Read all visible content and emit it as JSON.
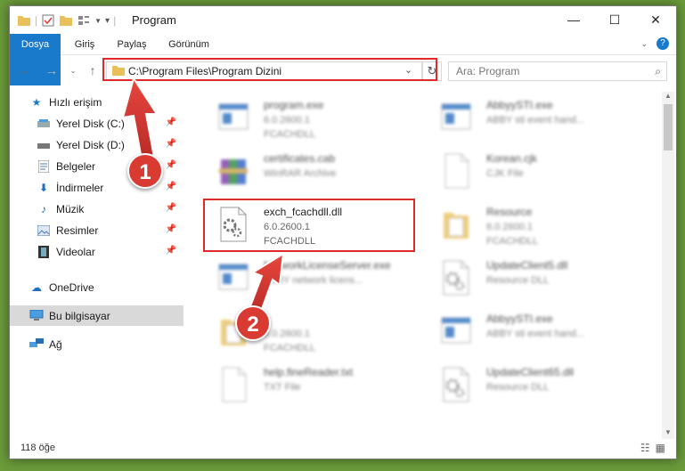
{
  "window": {
    "title": "Program",
    "controls": [
      "—",
      "☐",
      "✕"
    ]
  },
  "ribbon": {
    "tabs": [
      "Dosya",
      "Giriş",
      "Paylaş",
      "Görünüm"
    ],
    "help": "?"
  },
  "address": {
    "path": "C:\\Program Files\\Program Dizini",
    "search_placeholder": "Ara: Program"
  },
  "nav": {
    "quick_access": "Hızlı erişim",
    "items": [
      {
        "label": "Yerel Disk (C:)",
        "icon": "drive-icon",
        "pinned": true
      },
      {
        "label": "Yerel Disk (D:)",
        "icon": "drive-icon",
        "pinned": true
      },
      {
        "label": "Belgeler",
        "icon": "documents-icon",
        "pinned": true
      },
      {
        "label": "İndirmeler",
        "icon": "download-icon",
        "pinned": true
      },
      {
        "label": "Müzik",
        "icon": "music-icon",
        "pinned": true
      },
      {
        "label": "Resimler",
        "icon": "pictures-icon",
        "pinned": true
      },
      {
        "label": "Videolar",
        "icon": "video-icon",
        "pinned": true
      }
    ],
    "onedrive": "OneDrive",
    "this_pc": "Bu bilgisayar",
    "network": "Ağ"
  },
  "files": [
    {
      "name": "program.exe",
      "line2": "6.0.2600.1",
      "line3": "FCACHDLL",
      "icon": "exe-icon",
      "blurred": true
    },
    {
      "name": "AbbyySTI.exe",
      "line2": "ABBY sti event hand...",
      "line3": "",
      "icon": "exe-icon",
      "blurred": true
    },
    {
      "name": "certificates.cab",
      "line2": "WinRAR Archive",
      "line3": "",
      "icon": "archive-icon",
      "blurred": true
    },
    {
      "name": "Korean.cjk",
      "line2": "CJK File",
      "line3": "",
      "icon": "blank-file-icon",
      "blurred": true
    },
    {
      "name": "exch_fcachdll.dll",
      "line2": "6.0.2600.1",
      "line3": "FCACHDLL",
      "icon": "dll-icon",
      "blurred": false
    },
    {
      "name": "Resource",
      "line2": "6.0.2600.1",
      "line3": "FCACHDLL",
      "icon": "folder-file-icon",
      "blurred": true
    },
    {
      "name": "NetworkLicenseServer.exe",
      "line2": "ABBY network licens...",
      "line3": "",
      "icon": "exe-icon",
      "blurred": true
    },
    {
      "name": "UpdateClient5.dll",
      "line2": "Resource DLL",
      "line3": "",
      "icon": "dll-icon",
      "blurred": true
    },
    {
      "name": "",
      "line2": "6.0.2600.1",
      "line3": "FCACHDLL",
      "icon": "folder-file-icon",
      "blurred": true
    },
    {
      "name": "AbbyySTI.exe",
      "line2": "ABBY sti event hand...",
      "line3": "",
      "icon": "exe-icon",
      "blurred": true
    },
    {
      "name": "help.fineReader.txt",
      "line2": "TXT File",
      "line3": "",
      "icon": "blank-file-icon",
      "blurred": true
    },
    {
      "name": "UpdateClient65.dll",
      "line2": "Resource DLL",
      "line3": "",
      "icon": "dll-icon",
      "blurred": true
    }
  ],
  "status": "118 öğe",
  "annotations": [
    "1",
    "2"
  ],
  "colors": {
    "accent": "#1979ca",
    "highlight": "#e02a2a",
    "badge": "#d93a32"
  }
}
